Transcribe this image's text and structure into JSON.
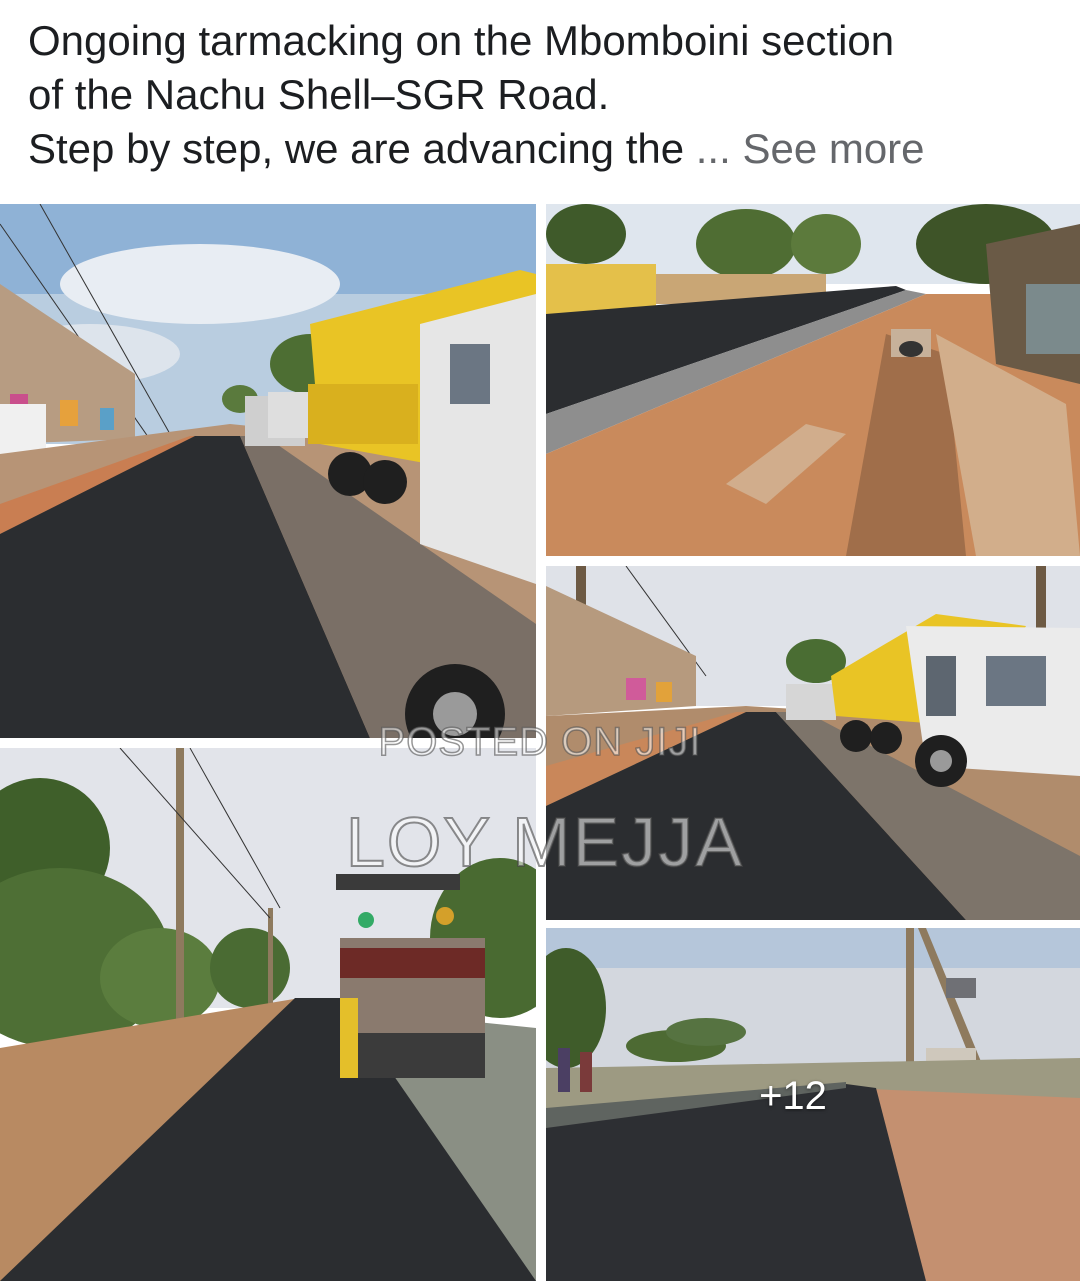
{
  "post": {
    "caption_line1": "Ongoing tarmacking on the Mbomboini section",
    "caption_line2": "of the Nachu Shell–SGR Road.",
    "caption_line3": "Step by step, we are advancing the",
    "see_more": "... See more"
  },
  "gallery": {
    "tiles": [
      {
        "name": "photo-trucks-on-road"
      },
      {
        "name": "photo-roadside-drainage"
      },
      {
        "name": "photo-truck-closeup"
      },
      {
        "name": "photo-road-roller"
      },
      {
        "name": "photo-junction-road"
      }
    ],
    "more_count": "+12"
  },
  "watermark": {
    "line1": "POSTED ON JIJI",
    "line2": "LOY MEJJA"
  },
  "colors": {
    "caption_text": "#1c1e21",
    "see_more": "#65676b",
    "truck_yellow": "#e9c425",
    "asphalt": "#2b2d30"
  }
}
